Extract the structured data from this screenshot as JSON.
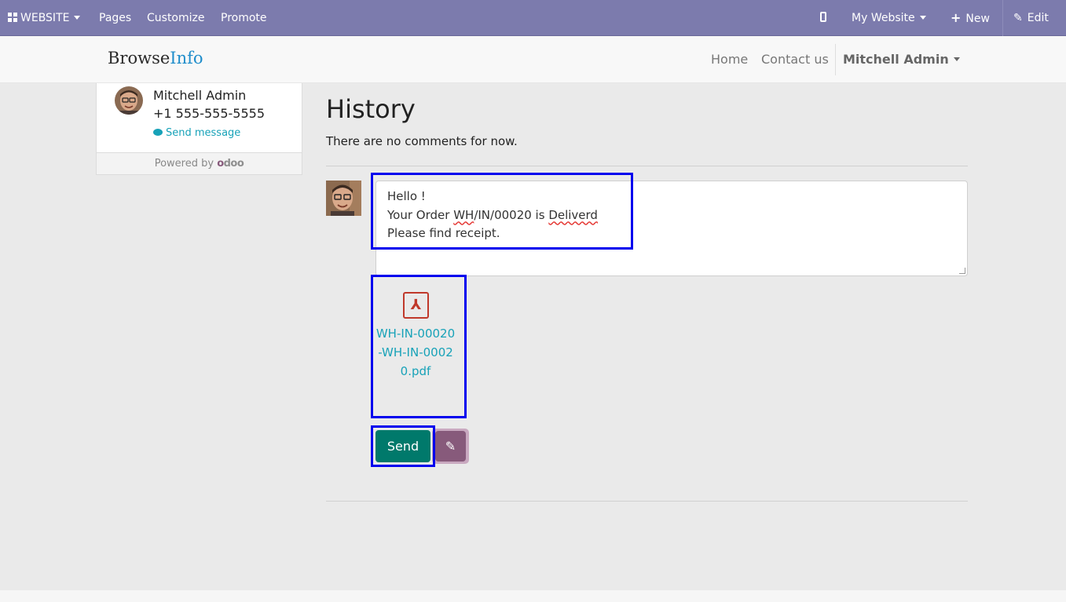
{
  "admin_bar": {
    "website_label": "WEBSITE",
    "pages_label": "Pages",
    "customize_label": "Customize",
    "promote_label": "Promote",
    "my_website_label": "My Website",
    "new_label": "New",
    "edit_label": "Edit",
    "background_color": "#7c7bad"
  },
  "site_header": {
    "brand_part1": "Browse",
    "brand_part2": "Info",
    "nav": {
      "home": "Home",
      "contact": "Contact us",
      "user": "Mitchell Admin"
    }
  },
  "contact_card": {
    "name": "Mitchell Admin",
    "phone": "+1 555-555-5555",
    "send_message": "Send message",
    "powered_by": "Powered by",
    "odoo_logo_text": "odoo"
  },
  "history": {
    "title": "History",
    "empty_text": "There are no comments for now.",
    "message_lines": [
      "Hello !",
      "Your Order WH/IN/00020 is Deliverd",
      "Please find receipt."
    ],
    "attachment_name": "WH-IN-00020-WH-IN-00020.pdf",
    "send_label": "Send",
    "attach_icon": "paperclip-icon"
  },
  "colors": {
    "send_button": "#00796b",
    "attach_button": "#875a7b",
    "link": "#17a2b8",
    "highlight": "#0000ee"
  }
}
